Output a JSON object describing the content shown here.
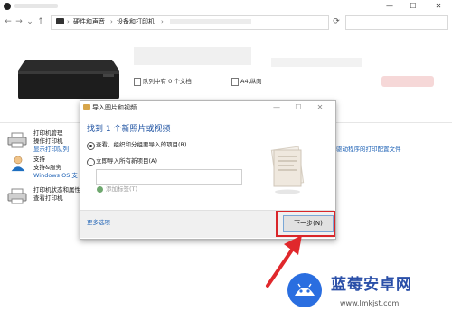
{
  "window": {
    "minimize": "—",
    "maximize": "☐",
    "close": "✕"
  },
  "breadcrumb": {
    "sep": "›",
    "items": [
      "硬件和声音",
      "设备和打印机"
    ]
  },
  "device": {
    "queue_status": "队列中有 0 个文档",
    "paper": "A4,纵向"
  },
  "left_list": {
    "printer_manage": "打印机管理",
    "operate_printer": "操作打印机",
    "show_queue": "显示打印队列",
    "support": "支持",
    "support_services": "支持&服务",
    "windows_os_link": "Windows OS 支",
    "status_title": "打印机状态和属性",
    "view_printer": "查看打印机"
  },
  "right_link": "驱动程序的打印配置文件",
  "dialog": {
    "title": "导入图片和视频",
    "heading": "找到 1 个新照片或视频",
    "option1": "查看、组织和分组要导入的项目(R)",
    "option2": "立即导入所有新项目(A)",
    "tag_placeholder": "",
    "add_tag": "添加标签(T)",
    "more_options": "更多选项",
    "next": "下一步(N)",
    "ctl_min": "—",
    "ctl_max": "☐",
    "ctl_close": "✕"
  },
  "watermark": {
    "title": "蓝莓安卓网",
    "url": "www.lmkjst.com"
  },
  "colors": {
    "highlight": "#d9262a",
    "link": "#1a5fb4",
    "heading": "#1a4fa0"
  }
}
